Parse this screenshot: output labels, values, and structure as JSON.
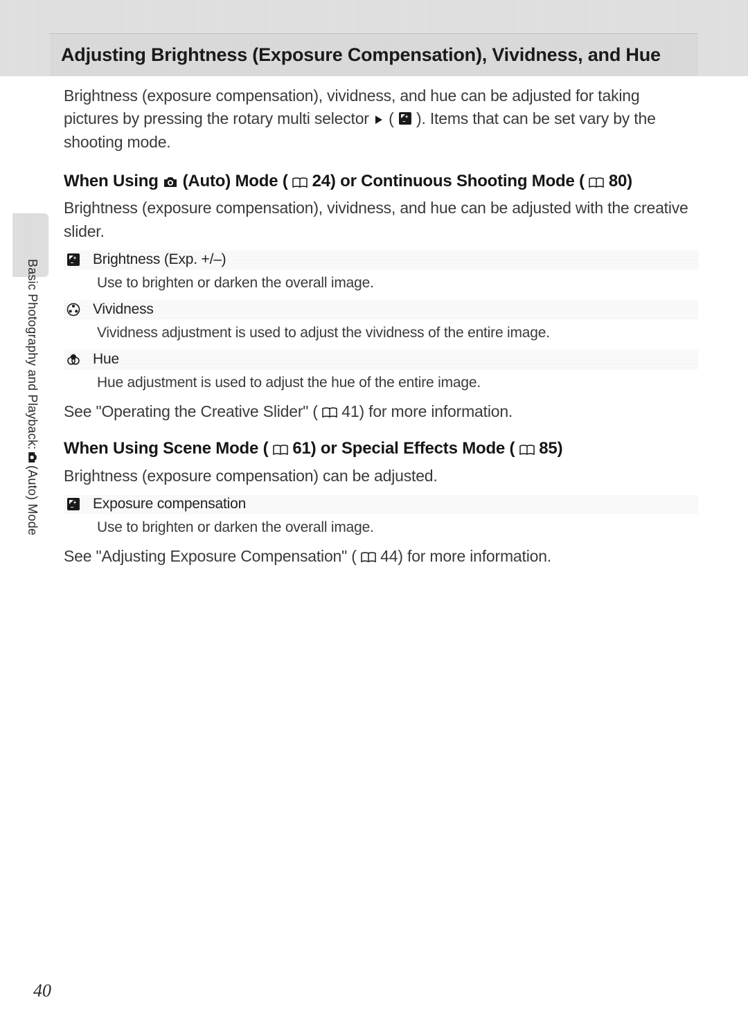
{
  "title": "Adjusting Brightness (Exposure Compensation), Vividness, and Hue",
  "intro_a": "Brightness (exposure compensation), vividness, and hue can be adjusted for taking pictures by pressing the rotary multi selector ",
  "intro_b": " (",
  "intro_c": "). Items that can be set vary by the shooting mode.",
  "section1": {
    "heading_a": "When Using ",
    "heading_b": " (Auto) Mode (",
    "heading_c": " 24) or Continuous Shooting Mode (",
    "heading_d": " 80)",
    "body": "Brightness (exposure compensation), vividness, and hue can be adjusted with the creative slider.",
    "options": [
      {
        "icon": "exp",
        "label": "Brightness (Exp. +/–)",
        "desc": "Use to brighten or darken the overall image."
      },
      {
        "icon": "vivid",
        "label": "Vividness",
        "desc": "Vividness adjustment is used to adjust the vividness of the entire image."
      },
      {
        "icon": "hue",
        "label": "Hue",
        "desc": "Hue adjustment is used to adjust the hue of the entire image."
      }
    ],
    "see_a": "See \"Operating the Creative Slider\" (",
    "see_b": " 41) for more information."
  },
  "section2": {
    "heading_a": "When Using Scene Mode (",
    "heading_b": " 61) or Special Effects Mode (",
    "heading_c": " 85)",
    "body": "Brightness (exposure compensation) can be adjusted.",
    "options": [
      {
        "icon": "exp",
        "label": "Exposure compensation",
        "desc": "Use to brighten or darken the overall image."
      }
    ],
    "see_a": "See \"Adjusting Exposure Compensation\" (",
    "see_b": " 44) for more information."
  },
  "side_a": "Basic Photography and Playback: ",
  "side_b": " (Auto) Mode",
  "page_number": "40"
}
